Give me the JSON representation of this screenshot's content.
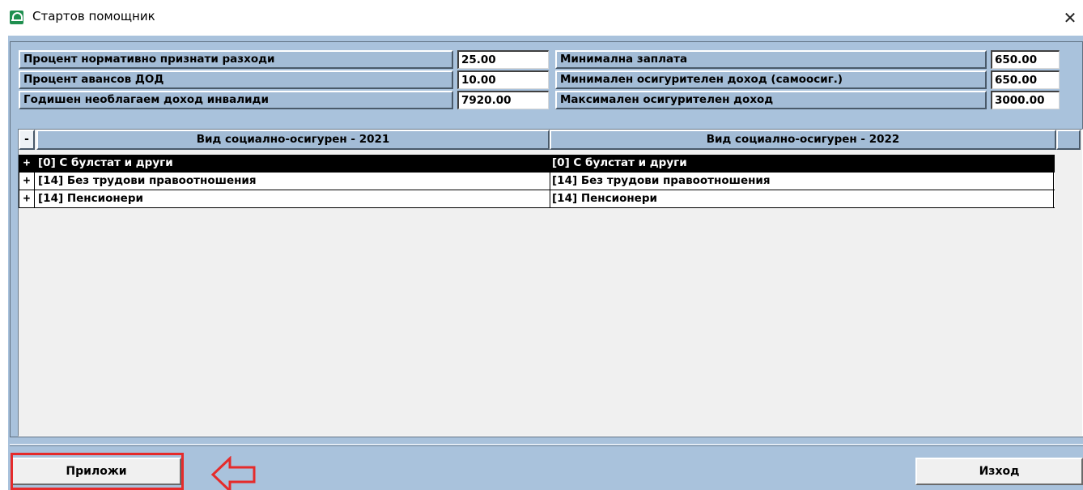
{
  "window": {
    "title": "Стартов помощник",
    "icon": "app-logo-icon",
    "close_icon": "close-icon",
    "close_glyph": "✕"
  },
  "params": {
    "left": [
      {
        "label": "Процент нормативно признати разходи",
        "value": "25.00"
      },
      {
        "label": "Процент авансов ДОД",
        "value": "10.00"
      },
      {
        "label": "Годишен необлагаем доход инвалиди",
        "value": "7920.00"
      }
    ],
    "right": [
      {
        "label": "Минимална заплата",
        "value": "650.00"
      },
      {
        "label": "Минимален осигурителен доход (самоосиг.)",
        "value": "650.00"
      },
      {
        "label": "Максимален осигурителен доход",
        "value": "3000.00"
      }
    ]
  },
  "grid": {
    "collapse_label": "-",
    "columns": [
      "Вид социално-осигурен - 2021",
      "Вид социално-осигурен - 2022"
    ],
    "rows": [
      {
        "expand": "+",
        "col_2021": "[0] С булстат и други",
        "col_2022": "[0] С булстат и други",
        "selected": true
      },
      {
        "expand": "+",
        "col_2021": "[14] Без трудови правоотношения",
        "col_2022": "[14] Без трудови правоотношения",
        "selected": false
      },
      {
        "expand": "+",
        "col_2021": "[14] Пенсионери",
        "col_2022": "[14] Пенсионери",
        "selected": false
      }
    ]
  },
  "buttons": {
    "apply_label": "Приложи",
    "exit_label": "Изход"
  },
  "colors": {
    "window_bg": "#a9c2dc",
    "header_bg": "#a3bcd6",
    "highlight": "#e52b2b",
    "selected_row": "#000000"
  },
  "annotation": {
    "marker_icon": "left-arrow-icon"
  }
}
